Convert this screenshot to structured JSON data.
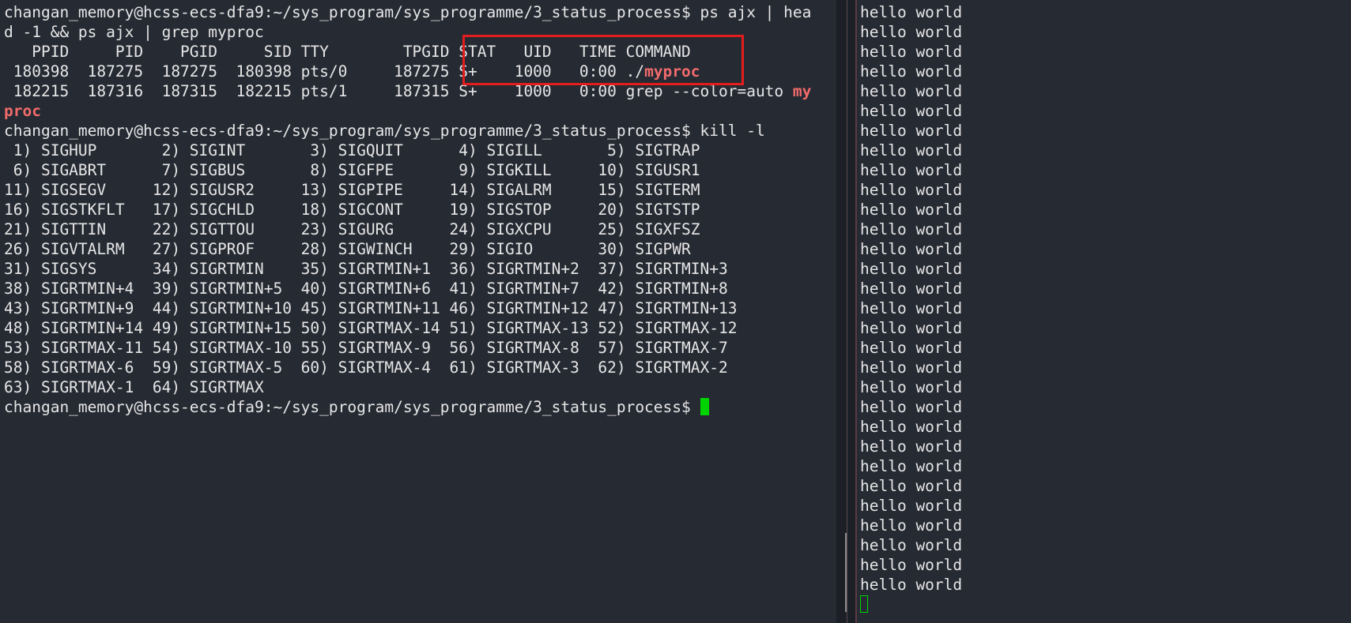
{
  "left_terminal": {
    "lines": [
      "changan_memory@hcss-ecs-dfa9:~/sys_program/sys_programme/3_status_process$ ps ajx | hea",
      "d -1 && ps ajx | grep myproc",
      "   PPID     PID    PGID     SID TTY        TPGID STAT   UID   TIME COMMAND",
      " 180398  187275  187275  180398 pts/0     187275 S+    1000   0:00 ./",
      " 182215  187316  187315  182215 pts/1     187315 S+    1000   0:00 grep --color=auto ",
      "",
      "changan_memory@hcss-ecs-dfa9:~/sys_program/sys_programme/3_status_process$ kill -l",
      " 1) SIGHUP       2) SIGINT       3) SIGQUIT      4) SIGILL       5) SIGTRAP",
      " 6) SIGABRT      7) SIGBUS       8) SIGFPE       9) SIGKILL     10) SIGUSR1",
      "11) SIGSEGV     12) SIGUSR2     13) SIGPIPE     14) SIGALRM     15) SIGTERM",
      "16) SIGSTKFLT   17) SIGCHLD     18) SIGCONT     19) SIGSTOP     20) SIGTSTP",
      "21) SIGTTIN     22) SIGTTOU     23) SIGURG      24) SIGXCPU     25) SIGXFSZ",
      "26) SIGVTALRM   27) SIGPROF     28) SIGWINCH    29) SIGIO       30) SIGPWR",
      "31) SIGSYS      34) SIGRTMIN    35) SIGRTMIN+1  36) SIGRTMIN+2  37) SIGRTMIN+3",
      "38) SIGRTMIN+4  39) SIGRTMIN+5  40) SIGRTMIN+6  41) SIGRTMIN+7  42) SIGRTMIN+8",
      "43) SIGRTMIN+9  44) SIGRTMIN+10 45) SIGRTMIN+11 46) SIGRTMIN+12 47) SIGRTMIN+13",
      "48) SIGRTMIN+14 49) SIGRTMIN+15 50) SIGRTMAX-14 51) SIGRTMAX-13 52) SIGRTMAX-12",
      "53) SIGRTMAX-11 54) SIGRTMAX-10 55) SIGRTMAX-9  56) SIGRTMAX-8  57) SIGRTMAX-7",
      "58) SIGRTMAX-6  59) SIGRTMAX-5  60) SIGRTMAX-4  61) SIGRTMAX-3  62) SIGRTMAX-2",
      "63) SIGRTMAX-1  64) SIGRTMAX",
      "changan_memory@hcss-ecs-dfa9:~/sys_program/sys_programme/3_status_process$ "
    ],
    "highlight_a": "myproc",
    "highlight_b": "my",
    "highlight_c": "proc"
  },
  "right_terminal": {
    "lines": [
      "hello world",
      "hello world",
      "hello world",
      "hello world",
      "hello world",
      "hello world",
      "hello world",
      "hello world",
      "hello world",
      "hello world",
      "hello world",
      "hello world",
      "hello world",
      "hello world",
      "hello world",
      "hello world",
      "hello world",
      "hello world",
      "hello world",
      "hello world",
      "hello world",
      "hello world",
      "hello world",
      "hello world",
      "hello world",
      "hello world",
      "hello world",
      "hello world",
      "hello world",
      "hello world"
    ]
  },
  "colors": {
    "background": "#262a33",
    "text": "#e6e6e6",
    "match_highlight": "#f26b6b",
    "cursor": "#00d400",
    "annotation_box": "#e21d1d"
  }
}
